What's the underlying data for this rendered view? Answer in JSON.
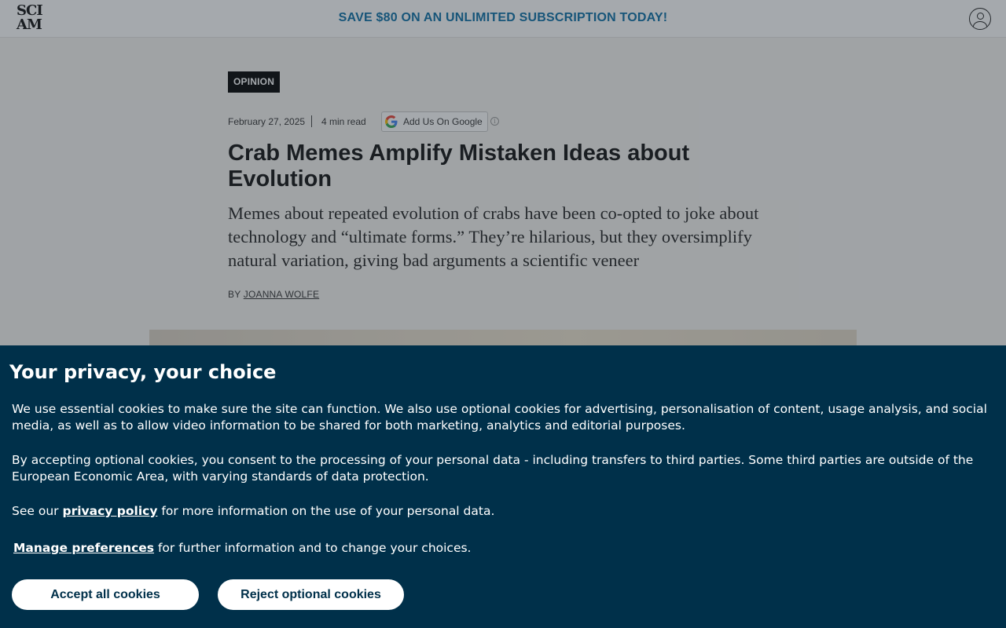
{
  "header": {
    "logo": {
      "line1": "SCI",
      "line2": "AM"
    },
    "promo": "SAVE $80 ON AN UNLIMITED SUBSCRIPTION TODAY!",
    "account_icon": "user-circle-icon"
  },
  "article": {
    "category": "OPINION",
    "date": "February 27, 2025",
    "read_time": "4 min read",
    "google_button": "Add Us On Google",
    "info_icon": "info-icon",
    "headline": "Crab Memes Amplify Mistaken Ideas about Evolution",
    "dek": "Memes about repeated evolution of crabs have been co-opted to joke about technology and “ultimate forms.” They’re hilarious, but they oversimplify natural variation, giving bad arguments a scientific veneer",
    "byline_prefix": "BY",
    "author": "JOANNA WOLFE"
  },
  "cookie_banner": {
    "title": "Your privacy, your choice",
    "paragraph1": "We use essential cookies to make sure the site can function. We also use optional cookies for advertising, personalisation of content, usage analysis, and social media, as well as to allow video information to be shared for both marketing, analytics and editorial purposes.",
    "paragraph2": "By accepting optional cookies, you consent to the processing of your personal data - including transfers to third parties. Some third parties are outside of the European Economic Area, with varying standards of data protection.",
    "see_our": "See our",
    "privacy_policy": "privacy policy",
    "see_our_suffix": "for more information on the use of your personal data.",
    "manage_preferences": "Manage preferences",
    "manage_suffix": "for further information and to change your choices.",
    "accept_button": "Accept all cookies",
    "reject_button": "Reject optional cookies"
  },
  "colors": {
    "promo": "#0b6fa6",
    "banner_background": "#00304a",
    "badge_background": "#000000"
  }
}
